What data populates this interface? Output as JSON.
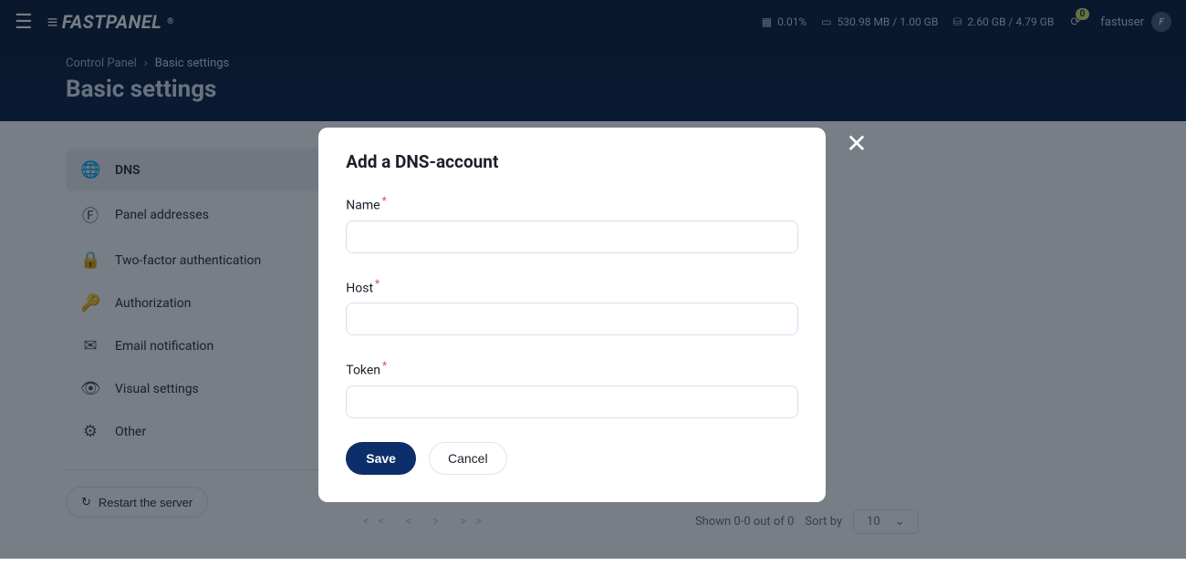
{
  "topbar": {
    "cpu_percent": "0.01%",
    "memory": "530.98 MB / 1.00 GB",
    "disk": "2.60 GB / 4.79 GB",
    "notifications": "0",
    "username": "fastuser",
    "avatar_initial": "F"
  },
  "breadcrumb": {
    "root": "Control Panel",
    "current": "Basic settings"
  },
  "page_title": "Basic settings",
  "sidebar": {
    "items": [
      {
        "icon": "globe",
        "label": "DNS",
        "active": true
      },
      {
        "icon": "circle-f",
        "label": "Panel addresses",
        "active": false
      },
      {
        "icon": "lock",
        "label": "Two-factor authentication",
        "active": false
      },
      {
        "icon": "key",
        "label": "Authorization",
        "active": false
      },
      {
        "icon": "mail",
        "label": "Email notification",
        "active": false
      },
      {
        "icon": "eye",
        "label": "Visual settings",
        "active": false
      },
      {
        "icon": "gear",
        "label": "Other",
        "active": false
      }
    ],
    "restart_label": "Restart the server"
  },
  "pagination": {
    "shown_text": "Shown 0-0 out of 0",
    "sort_label": "Sort by",
    "per_page": "10"
  },
  "modal": {
    "title": "Add a DNS-account",
    "fields": {
      "name_label": "Name",
      "name_value": "",
      "host_label": "Host",
      "host_value": "",
      "token_label": "Token",
      "token_value": ""
    },
    "save_label": "Save",
    "cancel_label": "Cancel"
  },
  "icons": {
    "globe": "🌐",
    "circle-f": "Ⓕ",
    "lock": "🔒",
    "key": "🔑",
    "mail": "✉",
    "eye": "👁",
    "gear": "⚙",
    "cpu": "▦",
    "ram": "▭",
    "disk": "⛁",
    "bell": "⟳",
    "refresh": "↻"
  }
}
